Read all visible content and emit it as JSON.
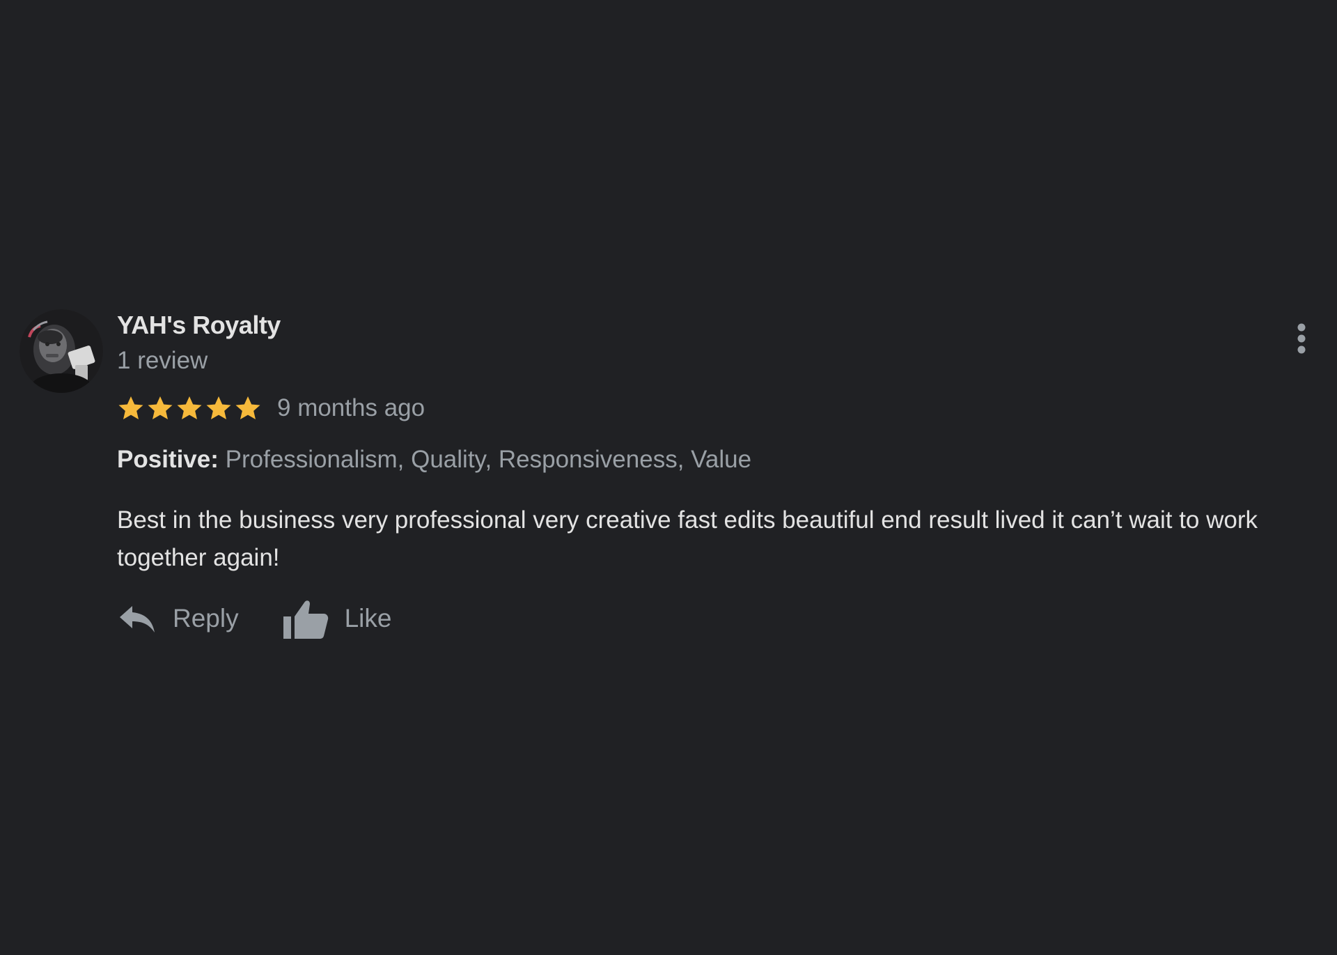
{
  "review": {
    "author": {
      "name": "YAH's Royalty",
      "meta": "1 review",
      "avatar_icon": "user-avatar-photo"
    },
    "rating": {
      "stars": 5,
      "max": 5,
      "star_color": "#f6b93b",
      "date": "9 months ago"
    },
    "attributes": {
      "label": "Positive:",
      "values": "Professionalism, Quality, Responsiveness, Value"
    },
    "text": "Best in the business very professional very creative fast edits beautiful end result lived it can’t wait to work together again!",
    "actions": {
      "reply_label": "Reply",
      "reply_icon": "reply-arrow-icon",
      "like_label": "Like",
      "like_icon": "thumbs-up-icon"
    },
    "menu_icon": "more-vert-icon"
  },
  "colors": {
    "background": "#202124",
    "primary_text": "#e3e3e3",
    "secondary_text": "#9aa0a6"
  }
}
